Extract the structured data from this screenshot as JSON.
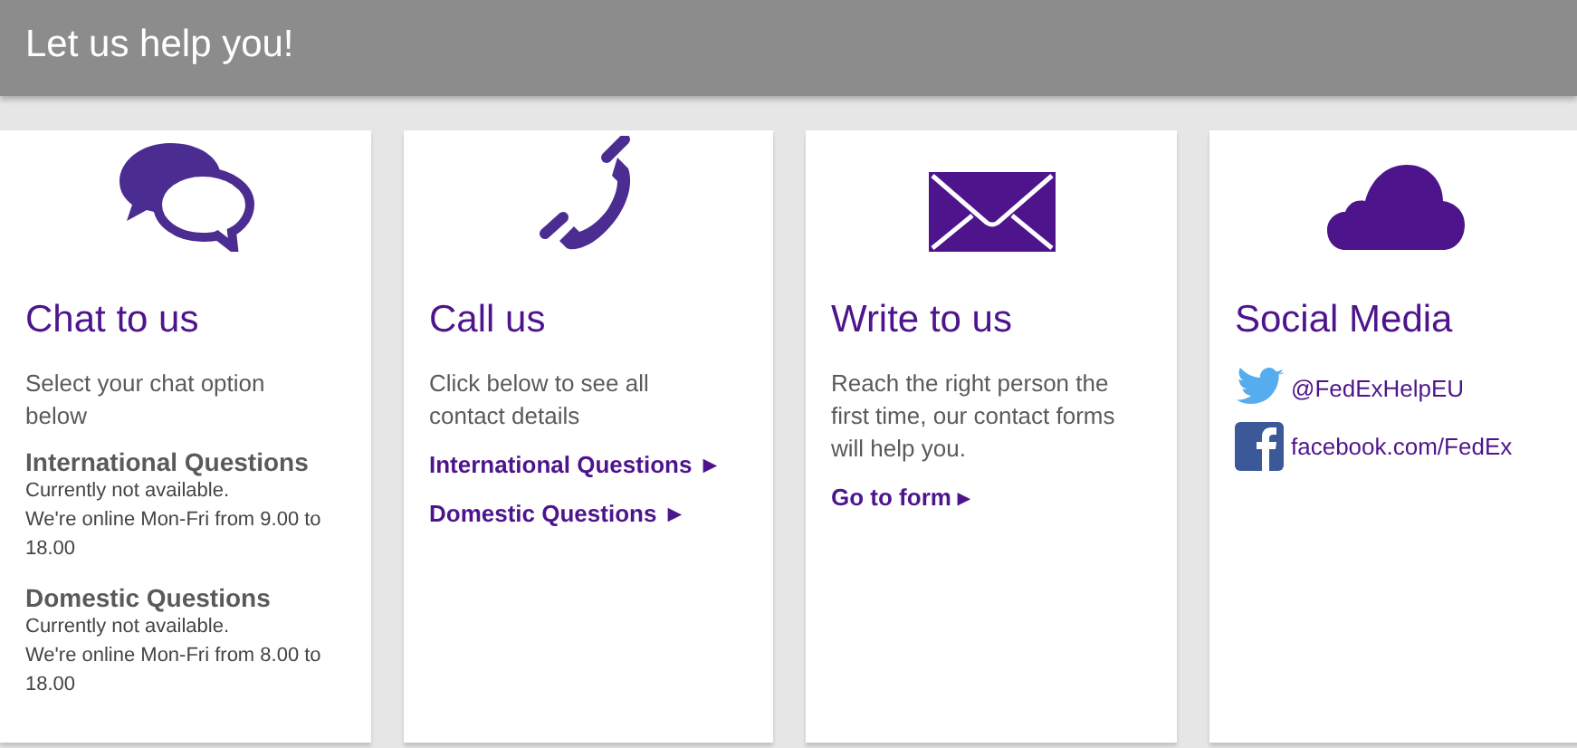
{
  "header": {
    "title": "Let us help you!"
  },
  "cards": [
    {
      "kind": "chat",
      "title": "Chat to us",
      "blocks": [
        {
          "kind": "text",
          "text": "Select your chat option below"
        },
        {
          "kind": "status",
          "heading": "International Questions",
          "lines": [
            "Currently not available.",
            "We're online Mon-Fri from 9.00 to 18.00"
          ]
        },
        {
          "kind": "status",
          "heading": "Domestic Questions",
          "lines": [
            "Currently not available.",
            "We're online Mon-Fri from 8.00 to 18.00"
          ]
        }
      ]
    },
    {
      "kind": "phone",
      "title": "Call us",
      "blocks": [
        {
          "kind": "text",
          "text": "Click below to see all contact details"
        },
        {
          "kind": "link",
          "text": "International Questions",
          "arrow": "►"
        },
        {
          "kind": "link",
          "text": "Domestic Questions",
          "arrow": "►"
        }
      ]
    },
    {
      "kind": "write",
      "title": "Write to us",
      "blocks": [
        {
          "kind": "text",
          "text": "Reach the right person the first time, our contact forms will help you."
        },
        {
          "kind": "link",
          "text": "Go to form",
          "arrow": "▸"
        }
      ]
    },
    {
      "kind": "social",
      "title": "Social Media",
      "blocks": [
        {
          "kind": "twitter",
          "text": "@FedExHelpEU"
        },
        {
          "kind": "facebook",
          "text": "facebook.com/FedEx"
        }
      ]
    }
  ]
}
